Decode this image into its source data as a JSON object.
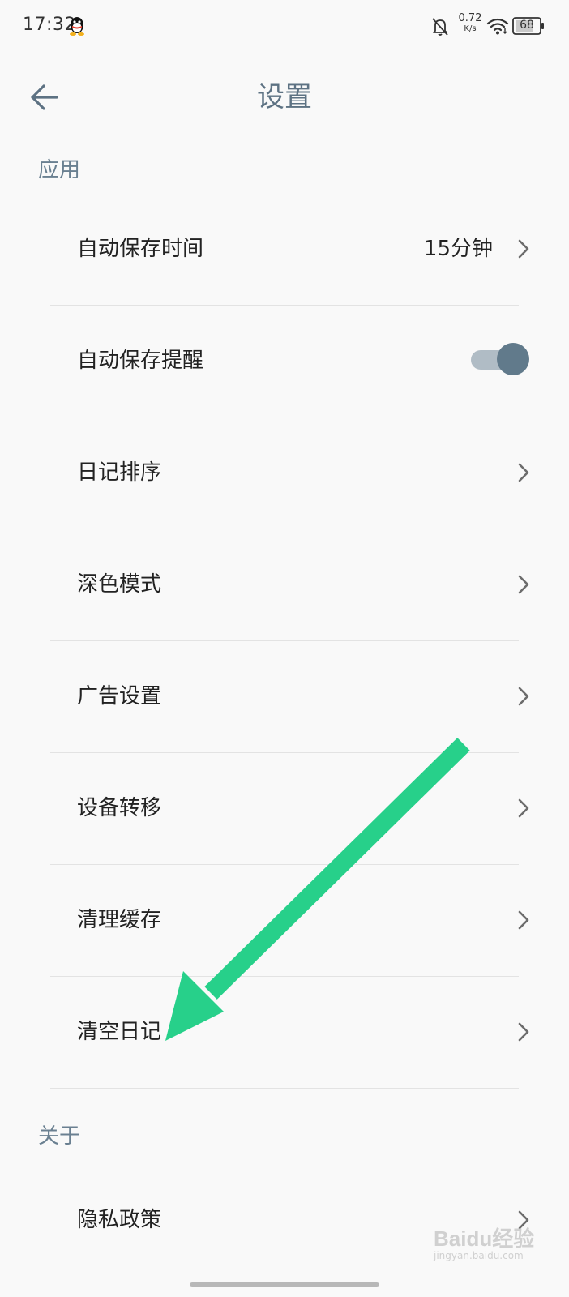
{
  "status_bar": {
    "time": "17:32",
    "net_speed_value": "0.72",
    "net_speed_unit": "K/s",
    "battery_level": "68",
    "icons": [
      "qq-icon",
      "bell-off-icon",
      "wifi-icon",
      "battery-icon"
    ]
  },
  "header": {
    "title": "设置",
    "back_icon": "arrow-left-icon"
  },
  "sections": [
    {
      "label": "应用",
      "items": [
        {
          "label": "自动保存时间",
          "value": "15分钟",
          "control": "chevron"
        },
        {
          "label": "自动保存提醒",
          "control": "toggle",
          "toggle_on": true
        },
        {
          "label": "日记排序",
          "control": "chevron"
        },
        {
          "label": "深色模式",
          "control": "chevron"
        },
        {
          "label": "广告设置",
          "control": "chevron"
        },
        {
          "label": "设备转移",
          "control": "chevron"
        },
        {
          "label": "清理缓存",
          "control": "chevron"
        },
        {
          "label": "清空日记",
          "control": "chevron"
        }
      ]
    },
    {
      "label": "关于",
      "items": [
        {
          "label": "隐私政策",
          "control": "chevron"
        }
      ]
    }
  ],
  "annotation": {
    "arrow_color": "#27d08a"
  },
  "watermark": {
    "mark": "Baidu经验",
    "sub": "jingyan.baidu.com"
  },
  "colors": {
    "title": "#5d7283",
    "section_label": "#6a8091",
    "toggle_thumb": "#617a8b",
    "toggle_track": "#b0bcc5",
    "background": "#f9f9f9"
  }
}
